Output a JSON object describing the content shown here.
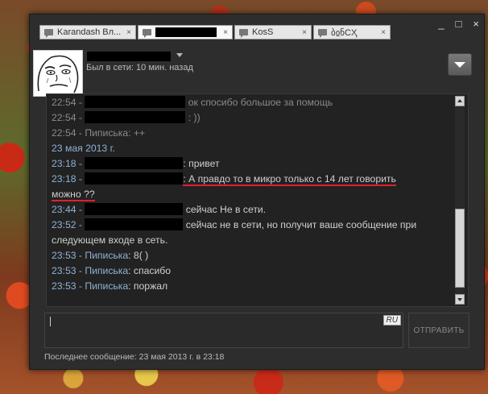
{
  "window": {
    "controls": {
      "minimize": "_",
      "maximize": "□",
      "close": "×"
    }
  },
  "tabs": [
    {
      "label": "Karandash Вл...",
      "close": "×"
    },
    {
      "label": "",
      "close": "×"
    },
    {
      "label": "KosS",
      "close": "×"
    },
    {
      "label": "ბჲნCҲ",
      "close": "×"
    }
  ],
  "contact": {
    "status": "Был в сети: 10 мин. назад"
  },
  "messages": [
    {
      "time": "22:54",
      "text": "ок  спосибо большое за помощь",
      "dim": true
    },
    {
      "time": "22:54",
      "text": ": ))",
      "dim": true
    },
    {
      "time": "22:54",
      "sender": "Пиписька",
      "text": ": ++",
      "dim": true
    },
    {
      "date": "23 мая 2013 г."
    },
    {
      "time": "23:18",
      "text": ": привет"
    },
    {
      "time": "23:18",
      "text": ": А правдо то в микро только с 14 лет говорить",
      "text2": "можно ??"
    },
    {
      "time": "23:44",
      "text": "сейчас Не в сети."
    },
    {
      "time": "23:52",
      "text": "сейчас не в сети, но получит ваше сообщение при",
      "text2": "следующем входе в сеть."
    },
    {
      "time": "23:53",
      "sender": "Пиписька",
      "text": ": 8( )"
    },
    {
      "time": "23:53",
      "sender": "Пиписька",
      "text": ": спасибо"
    },
    {
      "time": "23:53",
      "sender": "Пиписька",
      "text": ": поржал"
    }
  ],
  "input": {
    "lang": "RU"
  },
  "send_label": "ОТПРАВИТЬ",
  "footer": "Последнее сообщение: 23 мая 2013 г. в 23:18",
  "colors": {
    "time": "#8fb2d6",
    "text": "#cfcfcf",
    "underline": "#e0202a",
    "window": "#2d2d2d"
  }
}
